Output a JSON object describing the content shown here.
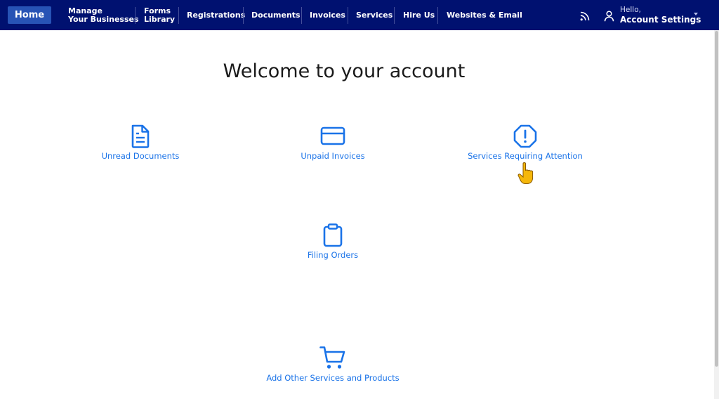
{
  "nav": {
    "home": "Home",
    "manage_line1": "Manage",
    "manage_line2": "Your Businesses",
    "forms_line1": "Forms",
    "forms_line2": "Library",
    "registrations": "Registrations",
    "documents": "Documents",
    "invoices": "Invoices",
    "services": "Services",
    "hire_us": "Hire Us",
    "websites_email": "Websites & Email",
    "hello": "Hello,",
    "account_settings": "Account Settings"
  },
  "main": {
    "title": "Welcome to your account",
    "tiles": [
      {
        "label": "Unread Documents",
        "icon": "document-icon"
      },
      {
        "label": "Unpaid Invoices",
        "icon": "credit-card-icon"
      },
      {
        "label": "Services Requiring Attention",
        "icon": "alert-octagon-icon"
      },
      {
        "label": "Filing Orders",
        "icon": "clipboard-icon"
      },
      {
        "label": "Add Other Services and Products",
        "icon": "cart-icon"
      }
    ]
  },
  "colors": {
    "navbar": "#001170",
    "home_button": "#2753b5",
    "link": "#1a73e8"
  }
}
